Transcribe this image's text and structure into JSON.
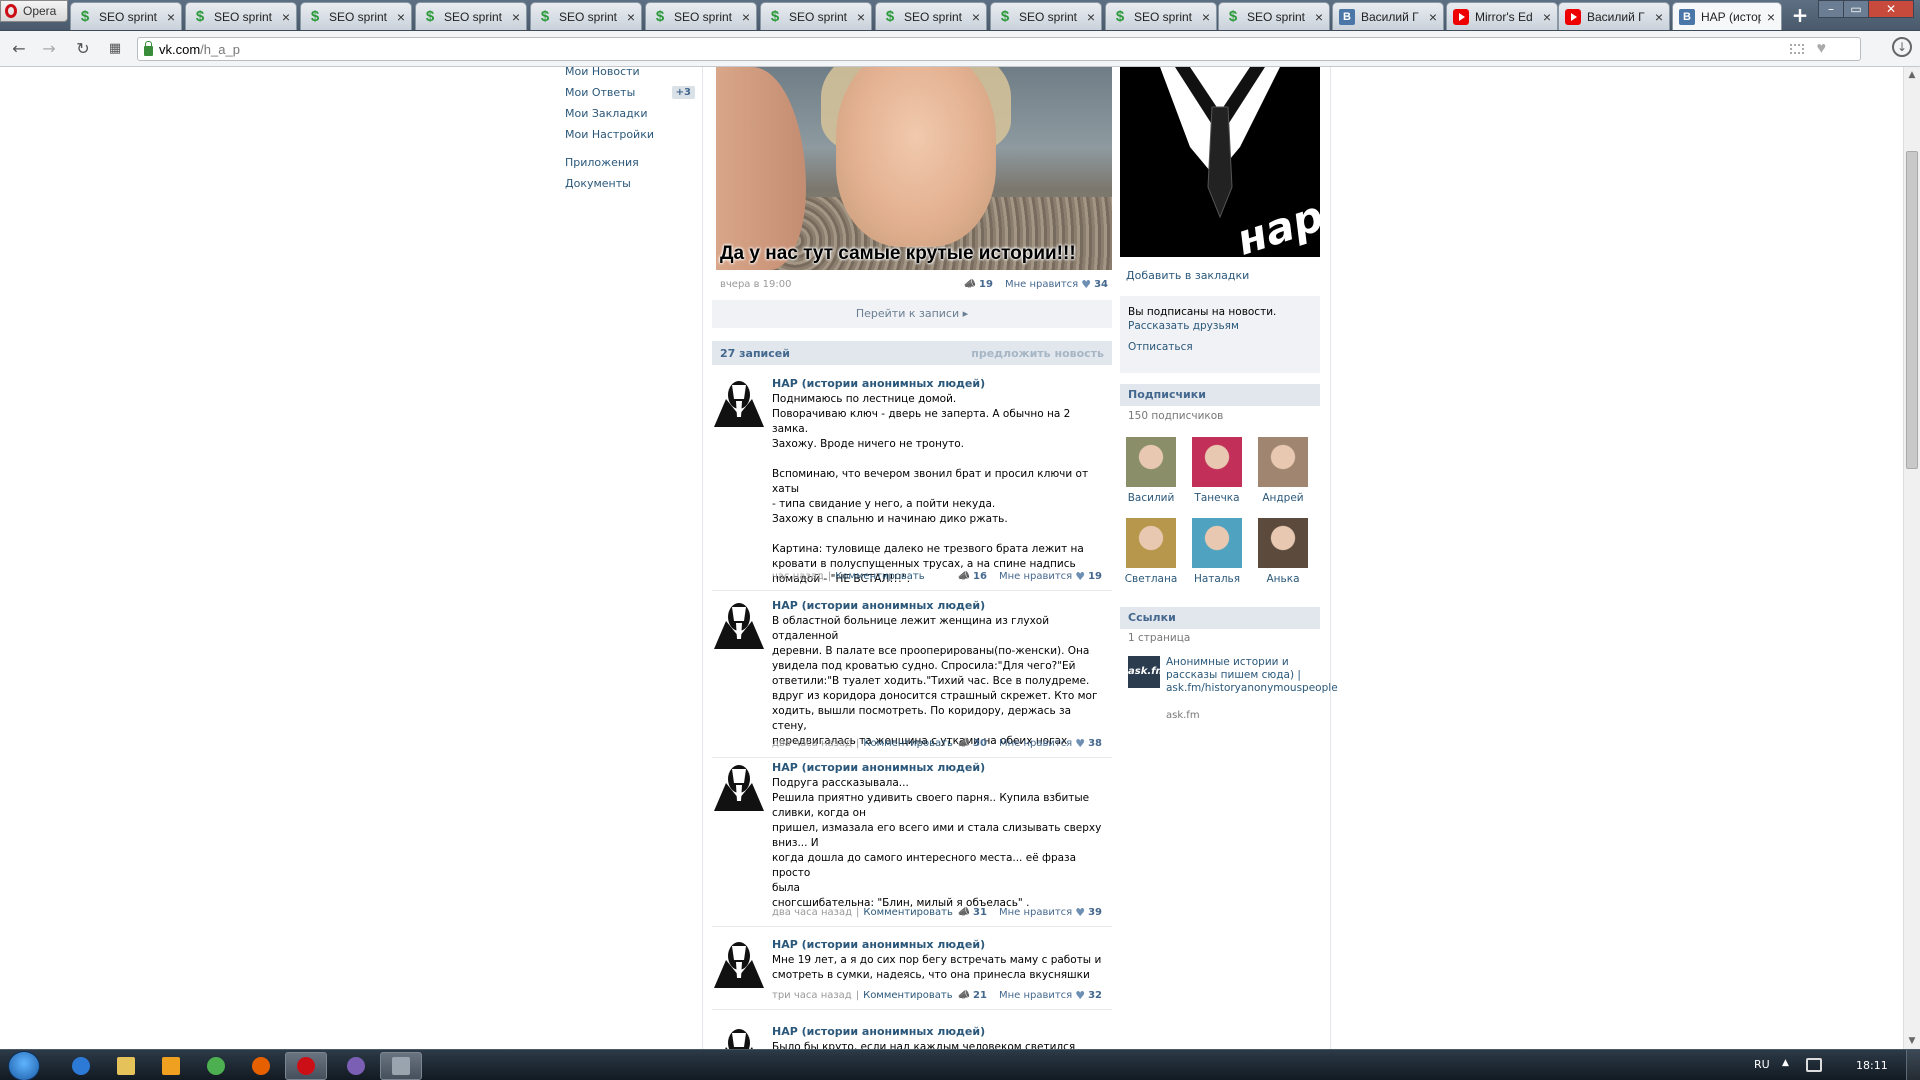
{
  "browser": {
    "menu_label": "Opera",
    "url_host": "vk.com",
    "url_path": "/h_a_p",
    "tabs": [
      {
        "label": "SEO sprint",
        "favicon": "seo-sprint-icon"
      },
      {
        "label": "SEO sprint",
        "favicon": "seo-sprint-icon"
      },
      {
        "label": "SEO sprint",
        "favicon": "seo-sprint-icon"
      },
      {
        "label": "SEO sprint",
        "favicon": "seo-sprint-icon"
      },
      {
        "label": "SEO sprint",
        "favicon": "seo-sprint-icon"
      },
      {
        "label": "SEO sprint",
        "favicon": "seo-sprint-icon"
      },
      {
        "label": "SEO sprint",
        "favicon": "seo-sprint-icon"
      },
      {
        "label": "SEO sprint",
        "favicon": "seo-sprint-icon"
      },
      {
        "label": "SEO sprint",
        "favicon": "seo-sprint-icon"
      },
      {
        "label": "SEO sprint",
        "favicon": "seo-sprint-icon"
      },
      {
        "label": "SEO sprint",
        "favicon": "seo-sprint-icon"
      },
      {
        "label": "Василий Г",
        "favicon": "vk-icon"
      },
      {
        "label": "Mirror's Ed",
        "favicon": "youtube-icon"
      },
      {
        "label": "Василий Г",
        "favicon": "youtube-icon"
      },
      {
        "label": "НАР (истор",
        "favicon": "vk-icon",
        "active": true
      }
    ]
  },
  "left_menu": {
    "items": [
      {
        "label": "Мои Новости"
      },
      {
        "label": "Мои Ответы",
        "count": "+3"
      },
      {
        "label": "Мои Закладки"
      },
      {
        "label": "Мои Настройки"
      }
    ],
    "items2": [
      {
        "label": "Приложения"
      },
      {
        "label": "Документы"
      }
    ]
  },
  "pinned_post": {
    "image_caption": "Да у нас тут самые крутые истории!!!",
    "time": "вчера в 19:00",
    "shares": "19",
    "like_label": "Мне нравится",
    "likes": "34"
  },
  "goto_post_label": "Перейти к записи",
  "posts_header": {
    "count_label": "27 записей",
    "suggest_label": "предложить новость"
  },
  "comment_label": "Комментировать",
  "like_label": "Мне нравится",
  "posts": [
    {
      "author": "НАР (истории анонимных людей)",
      "text": "Поднимаюсь по лестнице домой.\nПоворачиваю ключ - дверь не заперта. А обычно на 2 замка.\nЗахожу. Вроде ничего не тронуто.\n\nВспоминаю, что вечером звонил брат и просил ключи от хаты\n- типа свидание у него, а пойти некуда.\nЗахожу в спальню и начинаю дико ржать.\n\nКартина: туловище далеко не трезвого брата лежит на\nкровати в полуспущенных трусах, а на спине надпись\nпомадой - \"НЕ ВСТАЛ!!!\".",
      "time": "час назад",
      "shares": "16",
      "likes": "19"
    },
    {
      "author": "НАР (истории анонимных людей)",
      "text": "В областной больнице лежит женщина из глухой отдаленной\nдеревни. В палате все прооперированы(по-женски). Она\nувидела под кроватью судно. Спросила:\"Для чего?\"Ей\nответили:\"В туалет ходить.\"Тихий час. Все в полудреме.\nвдруг из коридора доносится страшный скрежет. Кто мог\nходить, вышли посмотреть. По коридору, держась за стену,\nпередвигалась та женщина с утками на обеих ногах",
      "time": "два часа назад",
      "shares": "30",
      "likes": "38"
    },
    {
      "author": "НАР (истории анонимных людей)",
      "text": "Подруга рассказывала...\nРешила приятно удивить своего парня.. Купила взбитые\nсливки, когда он\nпришел, измазала его всего ими и стала слизывать сверху\nвниз... И\nкогда дошла до самого интересного места... её фраза просто\nбыла\nсногсшибательна: \"Блин, милый я объелась\" .",
      "time": "два часа назад",
      "shares": "31",
      "likes": "39"
    },
    {
      "author": "НАР (истории анонимных людей)",
      "text": "Мне 19 лет, а я до сих пор бегу встречать маму с работы и\nсмотреть в сумки, надеясь, что она принесла вкусняшки",
      "time": "три часа назад",
      "shares": "21",
      "likes": "32"
    },
    {
      "author": "НАР (истории анонимных людей)",
      "text": "Было бы круто, если над каждым человеком светился",
      "time": "",
      "shares": "",
      "likes": ""
    }
  ],
  "right": {
    "group_logo_text": "нар",
    "bookmark_label": "Добавить в закладки",
    "subscribed_text": "Вы подписаны на новости.",
    "tell_friends": "Рассказать друзьям",
    "unsubscribe": "Отписаться",
    "followers_title": "Подписчики",
    "followers_count": "150 подписчиков",
    "followers": [
      {
        "name": "Василий",
        "color": "#8a8f6a"
      },
      {
        "name": "Танечка",
        "color": "#c2305a"
      },
      {
        "name": "Андрей",
        "color": "#a08670"
      },
      {
        "name": "Светлана",
        "color": "#b7974c"
      },
      {
        "name": "Наталья",
        "color": "#4fa3c0"
      },
      {
        "name": "Анька",
        "color": "#5c4a3d"
      }
    ],
    "links_title": "Ссылки",
    "links_count": "1 страница",
    "link": {
      "logo": "ask.fm",
      "title": "Анонимные истории и рассказы пишем сюда) | ask.fm/historyanonymouspeople",
      "domain": "ask.fm"
    }
  },
  "taskbar": {
    "lang": "RU",
    "clock": "18:11"
  }
}
